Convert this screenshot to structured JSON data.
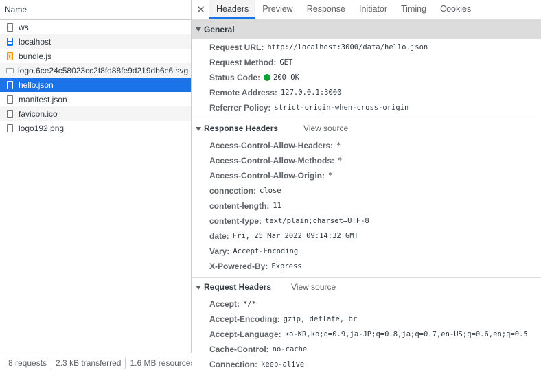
{
  "requests_header": "Name",
  "requests": [
    {
      "name": "ws",
      "icon": "blank-file-icon"
    },
    {
      "name": "localhost",
      "icon": "document-icon"
    },
    {
      "name": "bundle.js",
      "icon": "script-icon"
    },
    {
      "name": "logo.6ce24c58023cc2f8fd88fe9d219db6c6.svg",
      "icon": "image-icon"
    },
    {
      "name": "hello.json",
      "icon": "blank-file-icon",
      "selected": true
    },
    {
      "name": "manifest.json",
      "icon": "blank-file-icon"
    },
    {
      "name": "favicon.ico",
      "icon": "blank-file-icon"
    },
    {
      "name": "logo192.png",
      "icon": "blank-file-icon"
    }
  ],
  "status_bar": {
    "requests": "8 requests",
    "transferred": "2.3 kB transferred",
    "resources": "1.6 MB resources"
  },
  "tabs": [
    "Headers",
    "Preview",
    "Response",
    "Initiator",
    "Timing",
    "Cookies"
  ],
  "active_tab": "Headers",
  "general": {
    "title": "General",
    "request_url_label": "Request URL:",
    "request_url": "http://localhost:3000/data/hello.json",
    "request_method_label": "Request Method:",
    "request_method": "GET",
    "status_code_label": "Status Code:",
    "status_code": "200 OK",
    "remote_address_label": "Remote Address:",
    "remote_address": "127.0.0.1:3000",
    "referrer_policy_label": "Referrer Policy:",
    "referrer_policy": "strict-origin-when-cross-origin"
  },
  "response_headers": {
    "title": "Response Headers",
    "view_source": "View source",
    "rows": [
      {
        "name": "Access-Control-Allow-Headers:",
        "value": "*"
      },
      {
        "name": "Access-Control-Allow-Methods:",
        "value": "*"
      },
      {
        "name": "Access-Control-Allow-Origin:",
        "value": "*"
      },
      {
        "name": "connection:",
        "value": "close"
      },
      {
        "name": "content-length:",
        "value": "11"
      },
      {
        "name": "content-type:",
        "value": "text/plain;charset=UTF-8"
      },
      {
        "name": "date:",
        "value": "Fri, 25 Mar 2022 09:14:32 GMT"
      },
      {
        "name": "Vary:",
        "value": "Accept-Encoding"
      },
      {
        "name": "X-Powered-By:",
        "value": "Express"
      }
    ]
  },
  "request_headers": {
    "title": "Request Headers",
    "view_source": "View source",
    "rows": [
      {
        "name": "Accept:",
        "value": "*/*"
      },
      {
        "name": "Accept-Encoding:",
        "value": "gzip, deflate, br"
      },
      {
        "name": "Accept-Language:",
        "value": "ko-KR,ko;q=0.9,ja-JP;q=0.8,ja;q=0.7,en-US;q=0.6,en;q=0.5"
      },
      {
        "name": "Cache-Control:",
        "value": "no-cache"
      },
      {
        "name": "Connection:",
        "value": "keep-alive"
      }
    ]
  },
  "colors": {
    "selected_row": "#1a73e8",
    "status_ok": "#0fa534",
    "tab_underline": "#1a73e8"
  }
}
